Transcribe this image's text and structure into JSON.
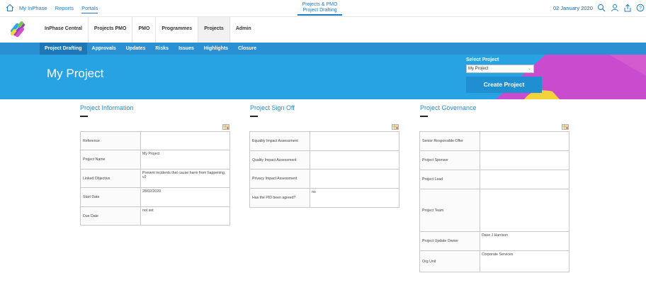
{
  "top": {
    "links": [
      "My InPhase",
      "Reports",
      "Portals"
    ],
    "center_title_1": "Projects & PMO",
    "center_title_2": "Project Drafting",
    "date": "02 January 2020"
  },
  "nav": [
    "InPhase Central",
    "Projects PMO",
    "PMO",
    "Programmes",
    "Projects",
    "Admin"
  ],
  "subnav": [
    "Project Drafting",
    "Approvals",
    "Updates",
    "Risks",
    "Issues",
    "Highlights",
    "Closure"
  ],
  "hero": {
    "title": "My Project",
    "select_label": "Select Project",
    "select_value": "My Project",
    "create_button": "Create Project"
  },
  "info": {
    "title": "Project Information",
    "rows": [
      {
        "label": "Reference",
        "value": ""
      },
      {
        "label": "Project Name",
        "value": "My Project"
      },
      {
        "label": "Linked Objective",
        "value": "Prevent incidents that cause harm from happening, v2"
      },
      {
        "label": "Start Date",
        "value": "28/02/2020"
      },
      {
        "label": "Due Date",
        "value": "not set"
      }
    ]
  },
  "signoff": {
    "title": "Project Sign Off",
    "rows": [
      {
        "label": "Equality Impact Assessment",
        "value": ""
      },
      {
        "label": "Quality Impact Assessment",
        "value": ""
      },
      {
        "label": "Privacy Impact Assessment",
        "value": ""
      },
      {
        "label": "Has the PID been agreed?",
        "value": "no"
      }
    ]
  },
  "gov": {
    "title": "Project Governance",
    "rows": [
      {
        "label": "Senior Responsible Offer",
        "value": ""
      },
      {
        "label": "Project Sponsor",
        "value": ""
      },
      {
        "label": "Project Lead",
        "value": ""
      },
      {
        "label": "Project Team",
        "value": ""
      },
      {
        "label": "Project Update Owner",
        "value": "Dave J Harrison"
      },
      {
        "label": "Org Unit",
        "value": "Corporate Services"
      }
    ]
  }
}
